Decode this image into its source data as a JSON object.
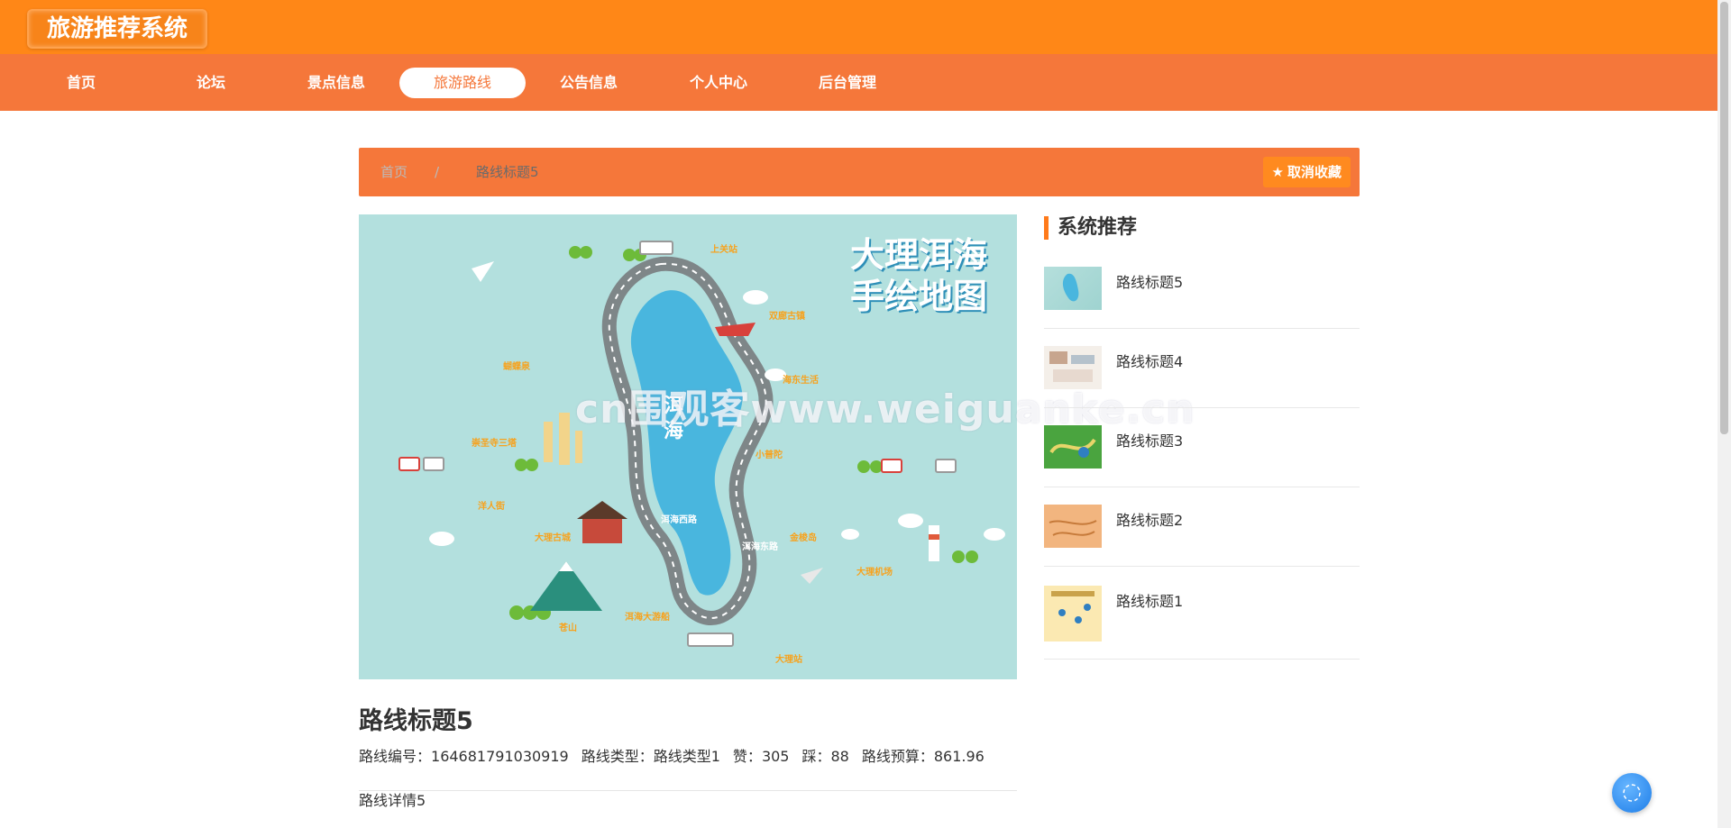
{
  "app": {
    "title": "旅游推荐系统"
  },
  "nav": {
    "items": [
      {
        "label": "首页"
      },
      {
        "label": "论坛"
      },
      {
        "label": "景点信息"
      },
      {
        "label": "旅游路线"
      },
      {
        "label": "公告信息"
      },
      {
        "label": "个人中心"
      },
      {
        "label": "后台管理"
      }
    ],
    "active": "旅游路线"
  },
  "breadcrumb": {
    "home": "首页",
    "separator": "/",
    "current": "路线标题5"
  },
  "favorite": {
    "label": "取消收藏",
    "icon": "star-icon"
  },
  "route": {
    "image": {
      "title_line1": "大理洱海",
      "title_line2": "手绘地图",
      "map_labels": [
        "上关站",
        "双廊古镇",
        "海东生活",
        "蝴蝶泉",
        "崇圣寺三塔",
        "洱海西路",
        "小普陀",
        "洱海东路",
        "洋人街",
        "大理古城",
        "金梭岛",
        "大理机场",
        "苍山",
        "洱海大游船",
        "大理站"
      ],
      "lake_label": "洱海"
    },
    "title": "路线标题5",
    "meta": {
      "code_label": "路线编号：",
      "code": "164681791030919",
      "type_label": "路线类型：",
      "type": "路线类型1",
      "like_label": "赞：",
      "likes": "305",
      "dislike_label": "踩：",
      "dislikes": "88",
      "budget_label": "路线预算：",
      "budget": "861.96"
    },
    "detail": "路线详情5"
  },
  "sidebar": {
    "title": "系统推荐",
    "items": [
      {
        "label": "路线标题5"
      },
      {
        "label": "路线标题4"
      },
      {
        "label": "路线标题3"
      },
      {
        "label": "路线标题2"
      },
      {
        "label": "路线标题1"
      }
    ]
  },
  "watermark": "cn围观客www.weiguanke.cn",
  "colors": {
    "header": "#ff8717",
    "nav": "#f5773a",
    "accent": "#ff7a1a"
  }
}
